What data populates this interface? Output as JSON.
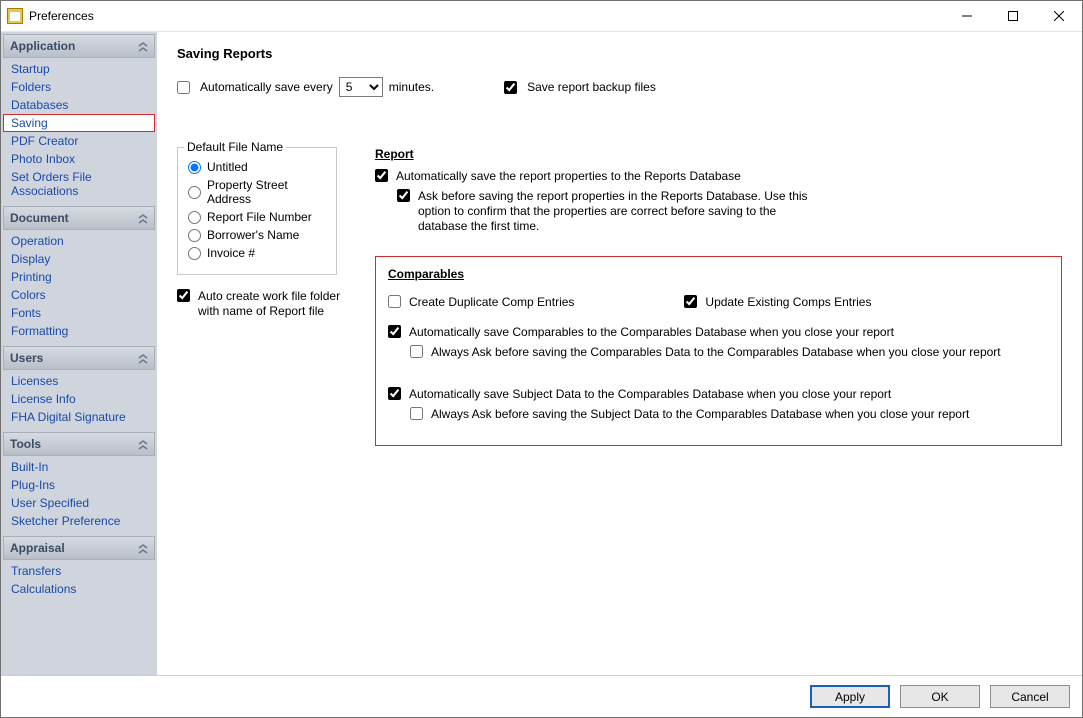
{
  "window": {
    "title": "Preferences"
  },
  "sidebar": {
    "groups": [
      {
        "title": "Application",
        "items": [
          "Startup",
          "Folders",
          "Databases",
          "Saving",
          "PDF Creator",
          "Photo Inbox",
          "Set Orders File Associations"
        ],
        "selectedIndex": 3
      },
      {
        "title": "Document",
        "items": [
          "Operation",
          "Display",
          "Printing",
          "Colors",
          "Fonts",
          "Formatting"
        ]
      },
      {
        "title": "Users",
        "items": [
          "Licenses",
          "License Info",
          "FHA Digital Signature"
        ]
      },
      {
        "title": "Tools",
        "items": [
          "Built-In",
          "Plug-Ins",
          "User Specified",
          "Sketcher Preference"
        ]
      },
      {
        "title": "Appraisal",
        "items": [
          "Transfers",
          "Calculations"
        ]
      }
    ]
  },
  "page": {
    "title": "Saving Reports",
    "autoSave": {
      "label": "Automatically save every",
      "interval": "5",
      "unit": "minutes.",
      "checked": false
    },
    "backup": {
      "label": "Save report backup files",
      "checked": true
    },
    "defaultFileName": {
      "legend": "Default File Name",
      "options": [
        "Untitled",
        "Property Street Address",
        "Report File Number",
        "Borrower's Name",
        "Invoice #"
      ],
      "selected": 0
    },
    "autoCreate": {
      "label": "Auto create work file folder with name of Report file",
      "checked": true
    },
    "report": {
      "heading": "Report",
      "autoSaveProps": {
        "label": "Automatically save the report properties to the Reports Database",
        "checked": true
      },
      "askBefore": {
        "label": "Ask before saving the report properties in the Reports Database. Use this option to confirm that the properties are correct before saving to the database the first time.",
        "checked": true
      }
    },
    "comparables": {
      "heading": "Comparables",
      "createDup": {
        "label": "Create Duplicate Comp Entries",
        "checked": false
      },
      "updateExisting": {
        "label": "Update Existing Comps Entries",
        "checked": true
      },
      "autoSaveComps": {
        "label": "Automatically save Comparables to the Comparables Database when you close your report",
        "checked": true
      },
      "askComps": {
        "label": "Always Ask before saving the Comparables Data to the Comparables Database when you close your report",
        "checked": false
      },
      "autoSaveSubject": {
        "label": "Automatically save Subject Data to the Comparables Database when you close your report",
        "checked": true
      },
      "askSubject": {
        "label": "Always Ask before saving the Subject Data to the Comparables Database when you close your report",
        "checked": false
      }
    }
  },
  "footer": {
    "apply": "Apply",
    "ok": "OK",
    "cancel": "Cancel"
  }
}
